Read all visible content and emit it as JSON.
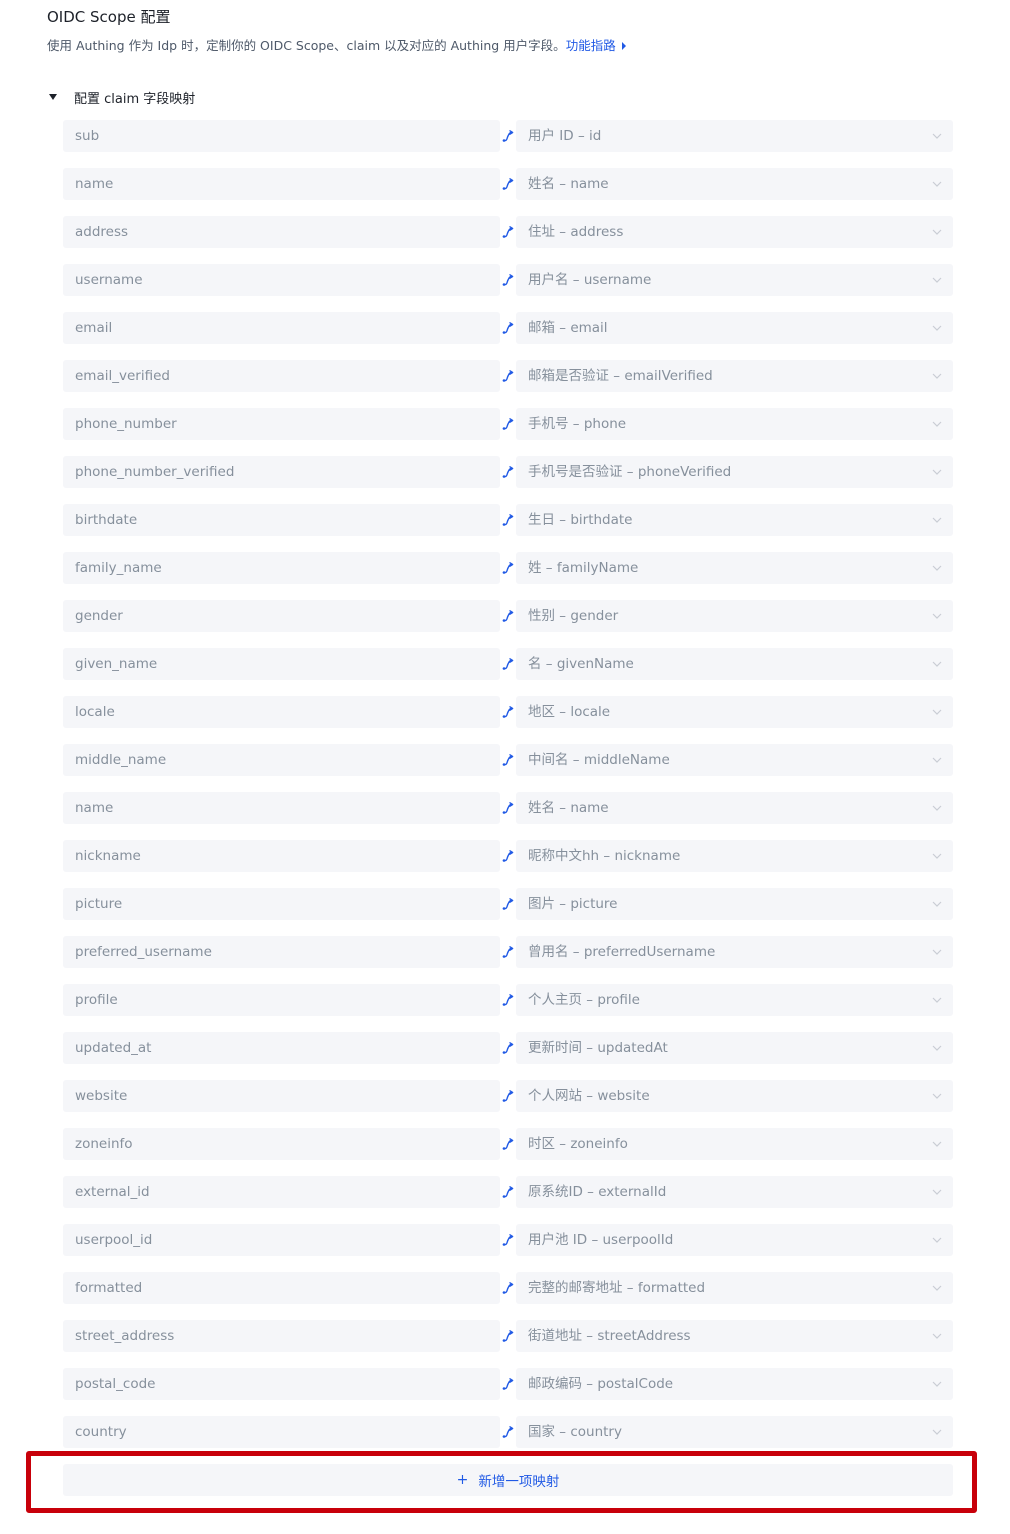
{
  "header": {
    "title": "OIDC Scope 配置",
    "subtitle": "使用 Authing 作为 Idp 时，定制你的 OIDC Scope、claim 以及对应的 Authing 用户字段。",
    "guide_link": "功能指路"
  },
  "section": {
    "label": "配置 claim 字段映射"
  },
  "colors": {
    "accent": "#215ae5",
    "input_bg": "#f5f6f9",
    "placeholder_text": "#86909c",
    "highlight": "#c8000a"
  },
  "mappings": [
    {
      "claim": "sub",
      "field": "用户 ID – id"
    },
    {
      "claim": "name",
      "field": "姓名 – name"
    },
    {
      "claim": "address",
      "field": "住址 – address"
    },
    {
      "claim": "username",
      "field": "用户名 – username"
    },
    {
      "claim": "email",
      "field": "邮箱 – email"
    },
    {
      "claim": "email_verified",
      "field": "邮箱是否验证 – emailVerified"
    },
    {
      "claim": "phone_number",
      "field": "手机号 – phone"
    },
    {
      "claim": "phone_number_verified",
      "field": "手机号是否验证 – phoneVerified"
    },
    {
      "claim": "birthdate",
      "field": "生日 – birthdate"
    },
    {
      "claim": "family_name",
      "field": "姓 – familyName"
    },
    {
      "claim": "gender",
      "field": "性别 – gender"
    },
    {
      "claim": "given_name",
      "field": "名 – givenName"
    },
    {
      "claim": "locale",
      "field": "地区 – locale"
    },
    {
      "claim": "middle_name",
      "field": "中间名 – middleName"
    },
    {
      "claim": "name",
      "field": "姓名 – name"
    },
    {
      "claim": "nickname",
      "field": "昵称中文hh – nickname"
    },
    {
      "claim": "picture",
      "field": "图片 – picture"
    },
    {
      "claim": "preferred_username",
      "field": "曾用名 – preferredUsername"
    },
    {
      "claim": "profile",
      "field": "个人主页 – profile"
    },
    {
      "claim": "updated_at",
      "field": "更新时间 – updatedAt"
    },
    {
      "claim": "website",
      "field": "个人网站 – website"
    },
    {
      "claim": "zoneinfo",
      "field": "时区 – zoneinfo"
    },
    {
      "claim": "external_id",
      "field": "原系统ID – externalId"
    },
    {
      "claim": "userpool_id",
      "field": "用户池 ID – userpoolId"
    },
    {
      "claim": "formatted",
      "field": "完整的邮寄地址 – formatted"
    },
    {
      "claim": "street_address",
      "field": "街道地址 – streetAddress"
    },
    {
      "claim": "postal_code",
      "field": "邮政编码 – postalCode"
    },
    {
      "claim": "country",
      "field": "国家 – country"
    }
  ],
  "add_button": {
    "icon": "+",
    "label": "新增一项映射"
  }
}
